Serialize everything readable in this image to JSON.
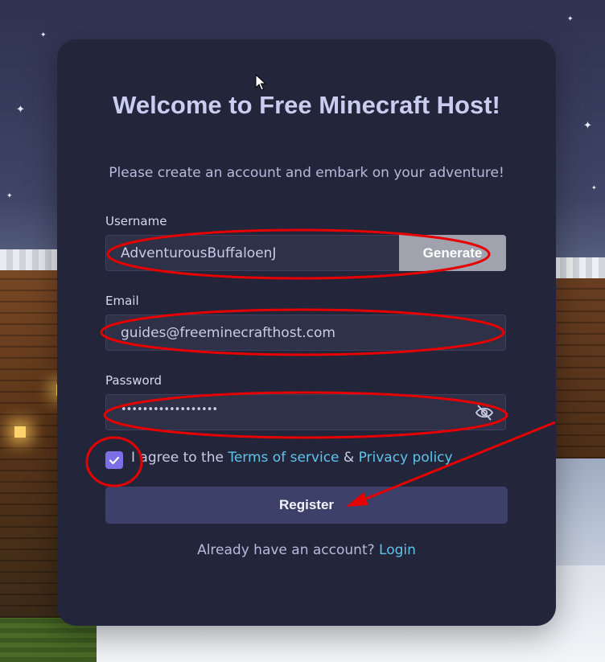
{
  "card": {
    "title": "Welcome to Free Minecraft Host!",
    "subtitle": "Please create an account and embark on your adventure!"
  },
  "form": {
    "username": {
      "label": "Username",
      "value": "AdventurousBuffaloenJ",
      "generate_label": "Generate"
    },
    "email": {
      "label": "Email",
      "value": "guides@freeminecrafthost.com"
    },
    "password": {
      "label": "Password",
      "masked_value": "••••••••••••••••••",
      "visibility_icon": "eye-slash-icon"
    },
    "agree": {
      "checked": true,
      "prefix": "I agree to the ",
      "terms_link": "Terms of service",
      "conjunction": " & ",
      "privacy_link": "Privacy policy"
    },
    "register_label": "Register",
    "login_prompt": "Already have an account? ",
    "login_link": "Login"
  },
  "colors": {
    "card_bg": "#23263a",
    "input_bg": "#2e3148",
    "accent_link": "#5fc4ea",
    "checkbox": "#7b6fe8",
    "register_btn": "#3d416a",
    "annotation": "#e60000"
  }
}
